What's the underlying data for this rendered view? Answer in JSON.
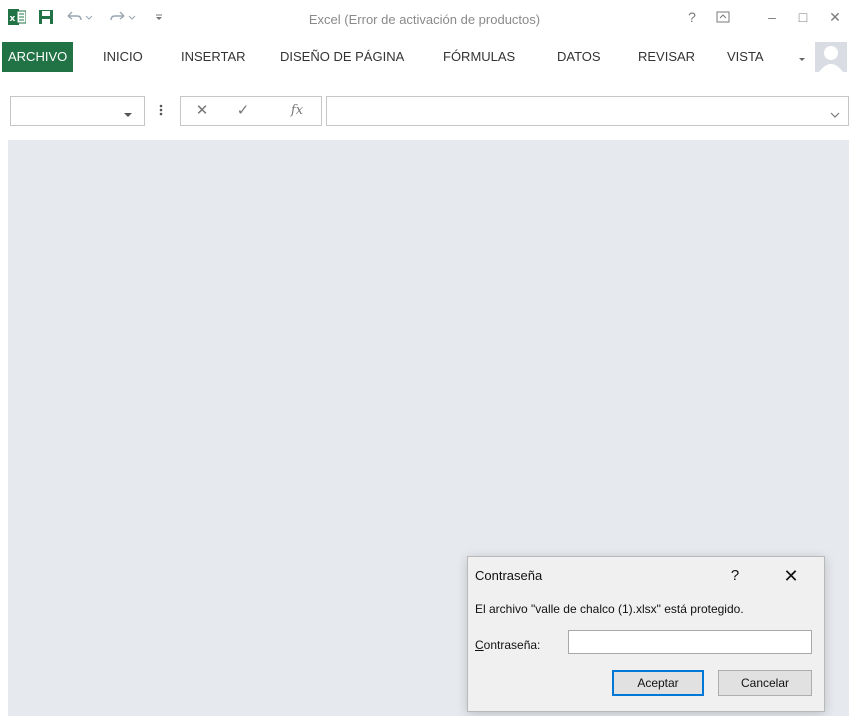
{
  "colors": {
    "accent": "#217346",
    "workspace": "#e6e9ee",
    "dialog_bg": "#f0f0f0",
    "default_button_border": "#0078d7"
  },
  "window": {
    "title": "Excel (Error de activación de productos)"
  },
  "quick_access": {
    "icons": [
      "excel-logo-icon",
      "save-icon",
      "undo-icon",
      "redo-icon",
      "customize-qat-icon"
    ]
  },
  "window_controls": {
    "help": "?",
    "ribbon_options": "ribbon-display-options-icon",
    "minimize": "–",
    "maximize": "□",
    "close": "✕"
  },
  "ribbon": {
    "tabs": [
      {
        "label": "ARCHIVO",
        "active": true
      },
      {
        "label": "INICIO"
      },
      {
        "label": "INSERTAR"
      },
      {
        "label": "DISEÑO DE PÁGINA"
      },
      {
        "label": "FÓRMULAS"
      },
      {
        "label": "DATOS"
      },
      {
        "label": "REVISAR"
      },
      {
        "label": "VISTA"
      }
    ],
    "more_icon": "chevron-down-icon",
    "user_icon": "user-avatar-icon"
  },
  "formula_bar": {
    "name_box_value": "",
    "cancel_glyph": "✕",
    "enter_glyph": "✓",
    "fx_label": "fx",
    "formula_value": ""
  },
  "dialog": {
    "title": "Contraseña",
    "help": "?",
    "close": "✕",
    "message": "El archivo \"valle de chalco (1).xlsx\" está protegido.",
    "password_label_accel": "C",
    "password_label_rest": "ontraseña:",
    "password_value": "",
    "ok_label": "Aceptar",
    "cancel_label": "Cancelar"
  }
}
